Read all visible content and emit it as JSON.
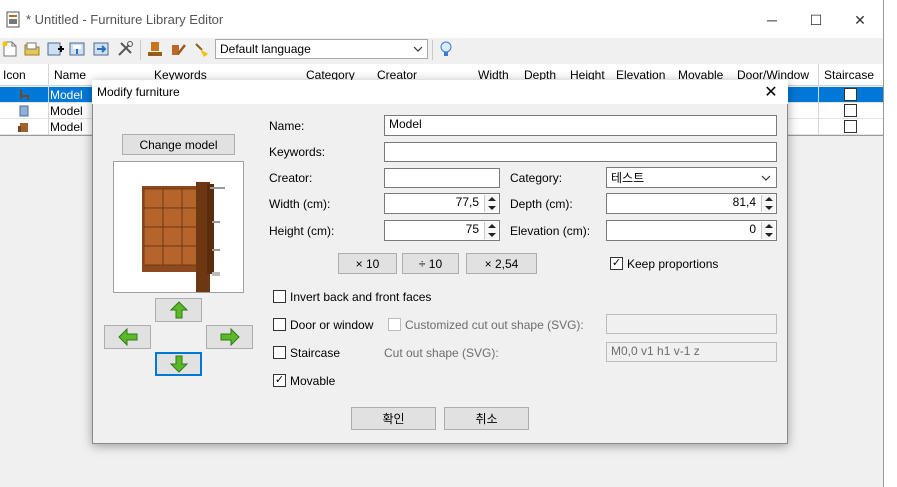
{
  "window": {
    "title": "* Untitled - Furniture Library Editor",
    "controls": {
      "minimize": "─",
      "maximize": "☐",
      "close": "✕"
    }
  },
  "toolbar": {
    "language_select": "Default language",
    "icons": [
      "new-file-icon",
      "open-folder-icon",
      "add-furniture-icon",
      "import-icon",
      "export-icon",
      "tools-icon",
      "import-model-icon",
      "modify-icon",
      "clean-icon",
      "help-bulb-icon"
    ]
  },
  "table": {
    "headers": [
      "Icon",
      "Name",
      "Keywords",
      "Category",
      "Creator",
      "Width",
      "Depth",
      "Height",
      "Elevation",
      "Movable",
      "Door/Window",
      "Staircase"
    ],
    "rows": [
      {
        "name": "Model",
        "selected": true
      },
      {
        "name": "Model",
        "selected": false
      },
      {
        "name": "Model",
        "selected": false
      }
    ]
  },
  "dialog": {
    "title": "Modify furniture",
    "close": "✕",
    "change_model_button": "Change model",
    "fields": {
      "name_label": "Name:",
      "name_value": "Model",
      "keywords_label": "Keywords:",
      "keywords_value": "",
      "creator_label": "Creator:",
      "creator_value": "",
      "category_label": "Category:",
      "category_value": "테스트",
      "width_label": "Width (cm):",
      "width_value": "77,5",
      "depth_label": "Depth (cm):",
      "depth_value": "81,4",
      "height_label": "Height (cm):",
      "height_value": "75",
      "elevation_label": "Elevation (cm):",
      "elevation_value": "0"
    },
    "scale_buttons": {
      "times10": "× 10",
      "div10": "÷ 10",
      "times254": "× 2,54"
    },
    "keep_proportions": {
      "label": "Keep proportions",
      "checked": true
    },
    "invert_faces": {
      "label": "Invert back and front faces",
      "checked": false
    },
    "door_or_window": {
      "label": "Door or window",
      "checked": false
    },
    "customized_cut_out": {
      "label": "Customized cut out shape (SVG):",
      "value": ""
    },
    "staircase": {
      "label": "Staircase",
      "checked": false
    },
    "cut_out_shape": {
      "label": "Cut out shape (SVG):",
      "value": "M0,0 v1 h1 v-1 z"
    },
    "movable": {
      "label": "Movable",
      "checked": true
    },
    "ok_button": "확인",
    "cancel_button": "취소",
    "check_mark": "✓"
  },
  "colors": {
    "selection": "#0078d7",
    "arrow_green": "#5cb82a",
    "dialog_bg": "#f0f0f0"
  }
}
